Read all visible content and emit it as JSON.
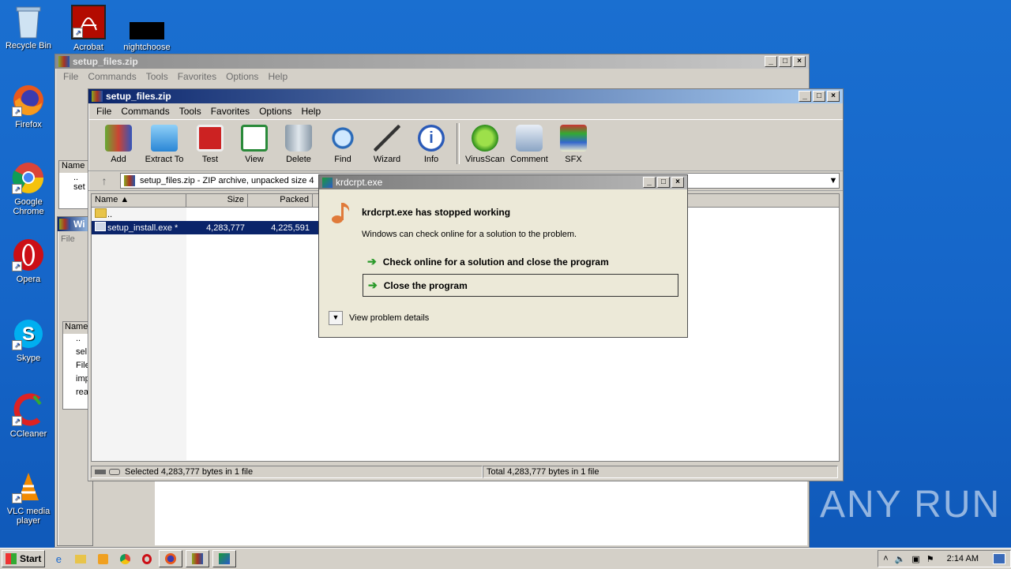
{
  "desktop": {
    "icons": [
      {
        "label": "Recycle Bin"
      },
      {
        "label": "Acrobat"
      },
      {
        "label": "nightchoose"
      },
      {
        "label": "Firefox"
      },
      {
        "label": "Google Chrome"
      },
      {
        "label": "Opera"
      },
      {
        "label": "Skype"
      },
      {
        "label": "CCleaner"
      },
      {
        "label": "VLC media player"
      }
    ]
  },
  "back_window": {
    "title": "setup_files.zip",
    "menu": [
      "File",
      "Commands",
      "Tools",
      "Favorites",
      "Options",
      "Help"
    ],
    "col_name": "Name",
    "rows": [
      "..",
      "set"
    ]
  },
  "third_window": {
    "title_partial": "Wi",
    "menu_file": "File",
    "col_name": "Name",
    "rows": [
      "..",
      "sel",
      "File",
      "imp",
      "rea"
    ]
  },
  "main_window": {
    "title": "setup_files.zip",
    "menu": [
      "File",
      "Commands",
      "Tools",
      "Favorites",
      "Options",
      "Help"
    ],
    "tools": [
      {
        "label": "Add",
        "icon": "add-archive-icon"
      },
      {
        "label": "Extract To",
        "icon": "extract-folder-icon"
      },
      {
        "label": "Test",
        "icon": "test-clipboard-icon"
      },
      {
        "label": "View",
        "icon": "view-book-icon"
      },
      {
        "label": "Delete",
        "icon": "trash-icon"
      },
      {
        "label": "Find",
        "icon": "magnifier-icon"
      },
      {
        "label": "Wizard",
        "icon": "wand-icon"
      },
      {
        "label": "Info",
        "icon": "info-icon"
      },
      {
        "label": "VirusScan",
        "icon": "bug-icon"
      },
      {
        "label": "Comment",
        "icon": "comment-icon"
      },
      {
        "label": "SFX",
        "icon": "sfx-box-icon"
      }
    ],
    "address": "setup_files.zip - ZIP archive, unpacked size 4",
    "columns": [
      "Name",
      "Size",
      "Packed"
    ],
    "files": [
      {
        "name": "..",
        "size": "",
        "packed": ""
      },
      {
        "name": "setup_install.exe *",
        "size": "4,283,777",
        "packed": "4,225,591"
      }
    ],
    "status_left": "Selected 4,283,777 bytes in 1 file",
    "status_right": "Total 4,283,777 bytes in 1 file"
  },
  "dialog": {
    "title": "krdcrpt.exe",
    "heading": "krdcrpt.exe has stopped working",
    "message": "Windows can check online for a solution to the problem.",
    "option1": "Check online for a solution and close the program",
    "option2": "Close the program",
    "details": "View problem details"
  },
  "taskbar": {
    "start": "Start",
    "time": "2:14 AM"
  },
  "watermark": "ANY RUN",
  "colors": {
    "selection": "#0a246a",
    "active_title": "#0a246a",
    "desktop": "#1565c8"
  }
}
